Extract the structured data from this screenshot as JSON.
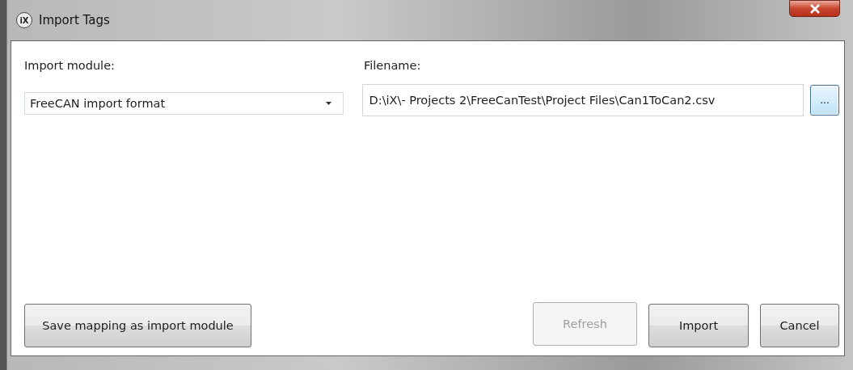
{
  "window": {
    "title": "Import Tags",
    "logo": "iX"
  },
  "import_module": {
    "label": "Import module:",
    "value": "FreeCAN import format"
  },
  "filename": {
    "label": "Filename:",
    "value": "D:\\iX\\- Projects 2\\FreeCanTest\\Project Files\\Can1ToCan2.csv",
    "browse": "..."
  },
  "buttons": [
    {
      "label": "Save mapping as import module",
      "disabled": false,
      "kind": "left"
    },
    {
      "label": "Refresh",
      "disabled": true,
      "kind": "right"
    },
    {
      "label": "Import",
      "disabled": false,
      "kind": "right"
    },
    {
      "label": "Cancel",
      "disabled": false,
      "kind": "right"
    }
  ]
}
